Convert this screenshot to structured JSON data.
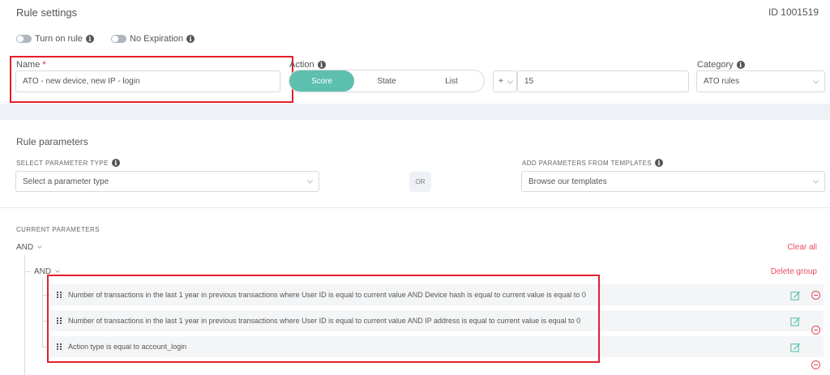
{
  "header": {
    "title": "Rule settings",
    "id_label": "ID 1001519"
  },
  "toggles": {
    "turn_on_rule": "Turn on rule",
    "no_expiration": "No Expiration"
  },
  "name_field": {
    "label": "Name",
    "required_mark": "*",
    "value": "ATO - new device, new IP - login"
  },
  "action": {
    "label": "Action",
    "options": [
      "Score",
      "State",
      "List"
    ],
    "selected": "Score",
    "sign": "+",
    "value": "15"
  },
  "category": {
    "label": "Category",
    "value": "ATO rules"
  },
  "rule_parameters": {
    "title": "Rule parameters",
    "select_type_label": "SELECT PARAMETER TYPE",
    "select_type_placeholder": "Select a parameter type",
    "or_label": "OR",
    "templates_label": "ADD PARAMETERS FROM TEMPLATES",
    "templates_placeholder": "Browse our templates"
  },
  "current_parameters": {
    "title": "CURRENT PARAMETERS",
    "root_operator": "AND",
    "clear_all": "Clear all",
    "group_operator": "AND",
    "delete_group": "Delete group",
    "rows": [
      "Number of transactions in the last 1 year in previous transactions where User ID is equal to current value AND Device hash is equal to current value is equal to 0",
      "Number of transactions in the last 1 year in previous transactions where User ID is equal to current value AND IP address is equal to current value is equal to 0",
      "Action type is equal to account_login"
    ]
  },
  "colors": {
    "accent": "#5dbfae",
    "highlight_border": "#e2202b",
    "danger": "#e84b5a",
    "edit": "#5dbfae"
  }
}
